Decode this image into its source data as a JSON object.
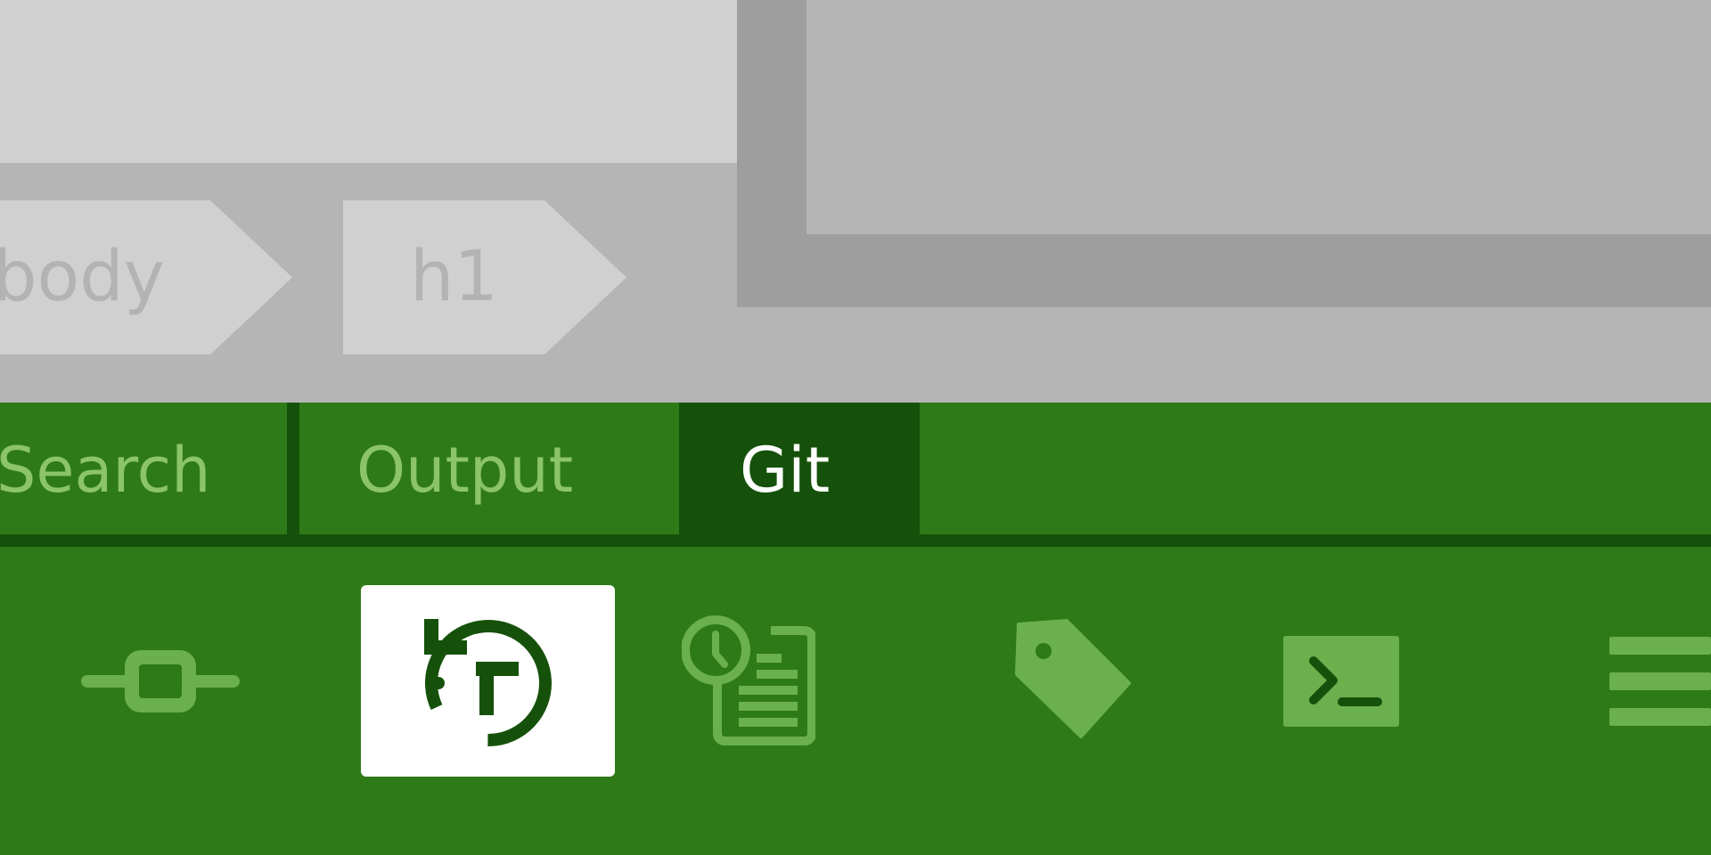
{
  "breadcrumb": {
    "items": [
      "body",
      "h1"
    ]
  },
  "tabs": [
    {
      "label": "Search",
      "active": false
    },
    {
      "label": "Output",
      "active": false
    },
    {
      "label": "Git",
      "active": true
    }
  ],
  "toolbar": {
    "icons": [
      "git-commit-icon",
      "revert-icon",
      "history-icon",
      "tag-icon",
      "terminal-icon",
      "menu-icon"
    ],
    "selected": "revert-icon"
  },
  "colors": {
    "panel_green": "#2f7a18",
    "dark_green": "#15510a",
    "light_green": "#6ab04c",
    "tab_text": "#8bc46a",
    "gray_light": "#d0d0d0",
    "gray_mid": "#b5b5b5",
    "gray_dark": "#9e9e9e"
  }
}
